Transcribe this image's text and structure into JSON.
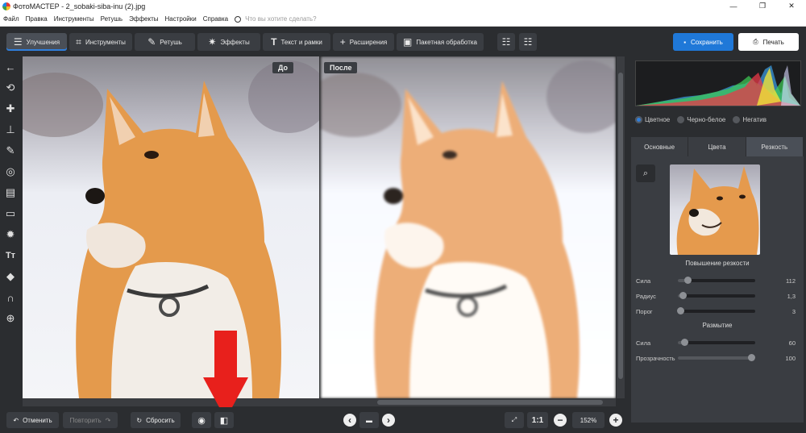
{
  "window": {
    "title": "ФотоМАСТЕР - 2_sobaki-siba-inu (2).jpg",
    "controls": [
      "—",
      "❐",
      "✕"
    ]
  },
  "menu": {
    "items": [
      "Файл",
      "Правка",
      "Инструменты",
      "Ретушь",
      "Эффекты",
      "Настройки",
      "Справка"
    ],
    "search_placeholder": "Что вы хотите сделать?"
  },
  "toolbar": {
    "tabs": [
      {
        "label": "Улучшения",
        "icon": "sliders-icon",
        "active": true
      },
      {
        "label": "Инструменты",
        "icon": "crop-icon",
        "active": false
      },
      {
        "label": "Ретушь",
        "icon": "brush-icon",
        "active": false
      },
      {
        "label": "Эффекты",
        "icon": "sparkle-icon",
        "active": false
      },
      {
        "label": "Текст и рамки",
        "icon": "text-icon",
        "active": false
      },
      {
        "label": "Расширения",
        "icon": "plus-icon",
        "active": false
      },
      {
        "label": "Пакетная обработка",
        "icon": "images-icon",
        "active": false
      }
    ],
    "save_label": "Сохранить",
    "print_label": "Печать",
    "accent": "#1f78d8"
  },
  "canvas": {
    "before_label": "До",
    "after_label": "После"
  },
  "bottom": {
    "undo_label": "Отменить",
    "redo_label": "Повторить",
    "reset_label": "Сбросить",
    "ratio_label": "1:1",
    "zoom": "152%"
  },
  "right_panel": {
    "modes": [
      {
        "label": "Цветное",
        "selected": true
      },
      {
        "label": "Черно-белое",
        "selected": false
      },
      {
        "label": "Негатив",
        "selected": false
      }
    ],
    "tabs": [
      {
        "label": "Основные",
        "active": false
      },
      {
        "label": "Цвета",
        "active": false
      },
      {
        "label": "Резкость",
        "active": true
      }
    ],
    "sharpen_title": "Повышение резкости",
    "sharpen": [
      {
        "label": "Сила",
        "value": "112",
        "position": 0.12
      },
      {
        "label": "Радиус",
        "value": "1,3",
        "position": 0.06
      },
      {
        "label": "Порог",
        "value": "3",
        "position": 0.03
      }
    ],
    "blur_title": "Размытие",
    "blur": [
      {
        "label": "Сила",
        "value": "60",
        "position": 0.08
      },
      {
        "label": "Прозрачность",
        "value": "100",
        "position": 0.95
      }
    ]
  }
}
